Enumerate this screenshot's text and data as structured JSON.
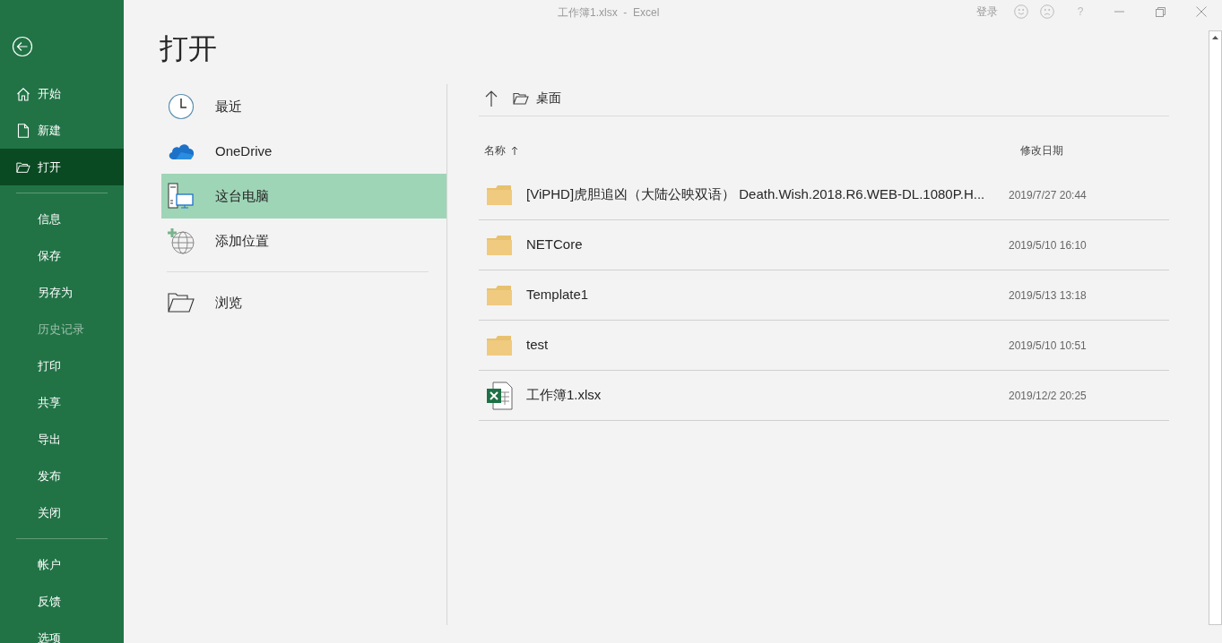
{
  "window": {
    "title": "工作簿1.xlsx  -  Excel",
    "sign_in": "登录",
    "help": "?"
  },
  "sidebar": {
    "groups": [
      [
        {
          "label": "开始",
          "kind": "home",
          "selected": false,
          "disabled": false
        },
        {
          "label": "新建",
          "kind": "new",
          "selected": false,
          "disabled": false
        },
        {
          "label": "打开",
          "kind": "open",
          "selected": true,
          "disabled": false
        }
      ],
      [
        {
          "label": "信息",
          "kind": "plain",
          "selected": false,
          "disabled": false
        },
        {
          "label": "保存",
          "kind": "plain",
          "selected": false,
          "disabled": false
        },
        {
          "label": "另存为",
          "kind": "plain",
          "selected": false,
          "disabled": false
        },
        {
          "label": "历史记录",
          "kind": "plain",
          "selected": false,
          "disabled": true
        },
        {
          "label": "打印",
          "kind": "plain",
          "selected": false,
          "disabled": false
        },
        {
          "label": "共享",
          "kind": "plain",
          "selected": false,
          "disabled": false
        },
        {
          "label": "导出",
          "kind": "plain",
          "selected": false,
          "disabled": false
        },
        {
          "label": "发布",
          "kind": "plain",
          "selected": false,
          "disabled": false
        },
        {
          "label": "关闭",
          "kind": "plain",
          "selected": false,
          "disabled": false
        }
      ],
      [
        {
          "label": "帐户",
          "kind": "plain",
          "selected": false,
          "disabled": false
        },
        {
          "label": "反馈",
          "kind": "plain",
          "selected": false,
          "disabled": false
        },
        {
          "label": "选项",
          "kind": "plain",
          "selected": false,
          "disabled": false
        }
      ]
    ]
  },
  "heading": "打开",
  "locations": {
    "groups": [
      [
        {
          "label": "最近",
          "kind": "recent",
          "selected": false
        },
        {
          "label": "OneDrive",
          "kind": "onedrive",
          "selected": false
        },
        {
          "label": "这台电脑",
          "kind": "pc",
          "selected": true
        },
        {
          "label": "添加位置",
          "kind": "add",
          "selected": false
        }
      ],
      [
        {
          "label": "浏览",
          "kind": "browse",
          "selected": false
        }
      ]
    ]
  },
  "browser": {
    "path": "桌面",
    "columns": [
      {
        "label": "名称",
        "sorted": true
      },
      {
        "label": "修改日期",
        "sorted": false
      }
    ],
    "rows": [
      {
        "name": "[ViPHD]虎胆追凶（大陆公映双语） Death.Wish.2018.R6.WEB-DL.1080P.H...",
        "modified": "2019/7/27 20:44",
        "kind": "folder"
      },
      {
        "name": "NETCore",
        "modified": "2019/5/10 16:10",
        "kind": "folder"
      },
      {
        "name": "Template1",
        "modified": "2019/5/13 13:18",
        "kind": "folder"
      },
      {
        "name": "test",
        "modified": "2019/5/10 10:51",
        "kind": "folder"
      },
      {
        "name": "工作簿1.xlsx",
        "modified": "2019/12/2 20:25",
        "kind": "excel"
      }
    ]
  }
}
